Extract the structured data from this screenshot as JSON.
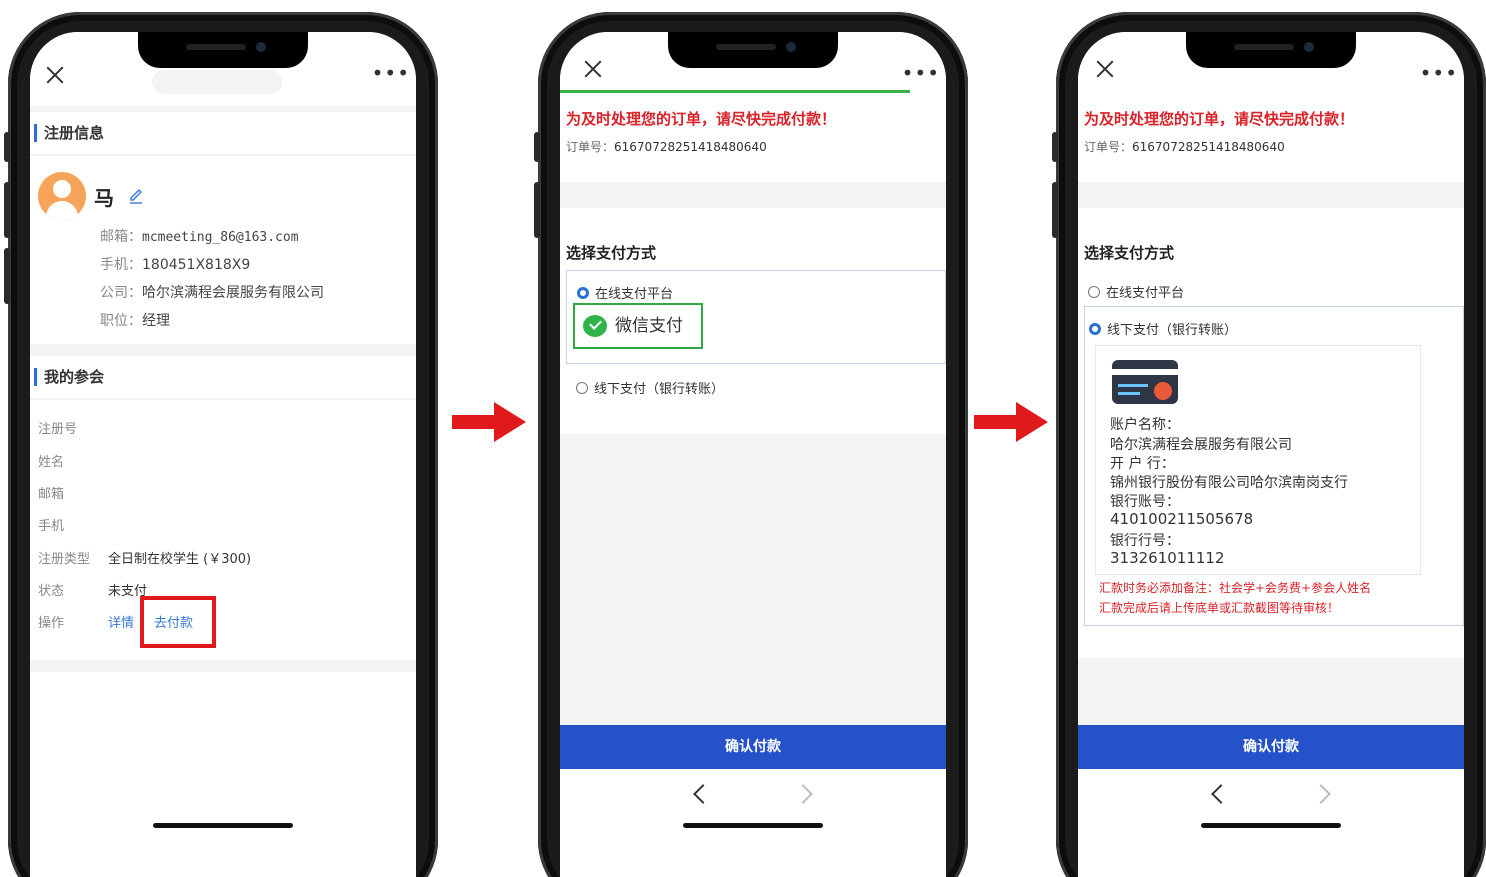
{
  "phone1": {
    "section_register": "注册信息",
    "user_name": "马",
    "email_label": "邮箱：",
    "email_value": "mcmeeting_86@163.com",
    "phone_label": "手机：",
    "phone_value": "180451X818X9",
    "company_label": "公司：",
    "company_value": "哈尔滨满程会展服务有限公司",
    "position_label": "职位：",
    "position_value": "经理",
    "section_meeting": "我的参会",
    "fields": [
      {
        "label": "注册号",
        "value": ""
      },
      {
        "label": "姓名",
        "value": ""
      },
      {
        "label": "邮箱",
        "value": ""
      },
      {
        "label": "手机",
        "value": ""
      },
      {
        "label": "注册类型",
        "value": "全日制在校学生 (￥300)"
      },
      {
        "label": "状态",
        "value": "未支付"
      }
    ],
    "action_label": "操作",
    "detail_link": "详情",
    "pay_link": "去付款"
  },
  "phone2": {
    "urgent": "为及时处理您的订单，请尽快完成付款！",
    "order_label": "订单号：",
    "order_no": "61670728251418480640",
    "choose_title": "选择支付方式",
    "online_label": "在线支付平台",
    "wechat_label": "微信支付",
    "offline_label": "线下支付（银行转账）",
    "confirm": "确认付款"
  },
  "phone3": {
    "urgent": "为及时处理您的订单，请尽快完成付款！",
    "order_label": "订单号：",
    "order_no": "61670728251418480640",
    "choose_title": "选择支付方式",
    "online_label": "在线支付平台",
    "offline_label": "线下支付（银行转账）",
    "account_name_label": "账户名称：",
    "account_name": "哈尔滨满程会展服务有限公司",
    "bank_label": "开 户 行：",
    "bank_name": "锦州银行股份有限公司哈尔滨南岗支行",
    "account_no_label": "银行账号：",
    "account_no": "410100211505678",
    "bank_code_label": "银行行号：",
    "bank_code": "313261011112",
    "notice1": "汇款时务必添加备注：社会学+会务费+参会人姓名",
    "notice2": "汇款完成后请上传底单或汇款截图等待审核！",
    "confirm": "确认付款"
  },
  "colors": {
    "accent_blue": "#2552c8",
    "link_blue": "#3a78d6",
    "alert_red": "#d8232a",
    "highlight_red": "#e0191c",
    "wechat_green": "#2fb34a"
  }
}
